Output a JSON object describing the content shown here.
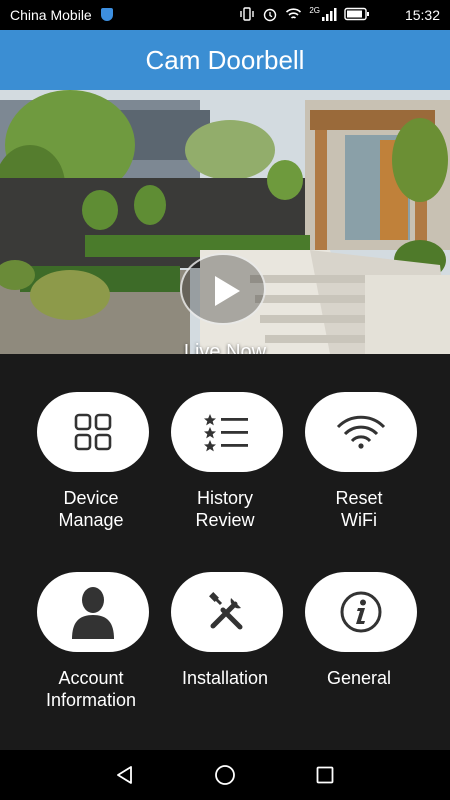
{
  "status_bar": {
    "carrier": "China Mobile",
    "network": "2G",
    "time": "15:32"
  },
  "app_bar": {
    "title": "Cam Doorbell"
  },
  "hero": {
    "live_label": "Live Now"
  },
  "menu": [
    {
      "label": "Device\nManage",
      "icon": "grid-icon"
    },
    {
      "label": "History\nReview",
      "icon": "list-icon"
    },
    {
      "label": "Reset\nWiFi",
      "icon": "wifi-icon"
    },
    {
      "label": "Account\nInformation",
      "icon": "user-icon"
    },
    {
      "label": "Installation",
      "icon": "tools-icon"
    },
    {
      "label": "General",
      "icon": "info-icon"
    }
  ],
  "colors": {
    "accent": "#3b8ed3",
    "background": "#1a1a1a",
    "tile": "#ffffff"
  }
}
